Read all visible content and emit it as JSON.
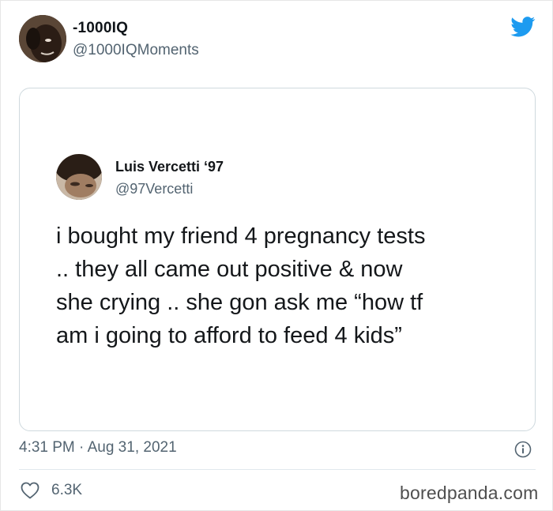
{
  "tweet": {
    "author": {
      "display_name": "-1000IQ",
      "handle": "@1000IQMoments"
    },
    "timestamp": "4:31 PM · Aug 31, 2021",
    "likes": "6.3K"
  },
  "quoted_tweet": {
    "author": {
      "display_name": "Luis Vercetti ‘97",
      "handle": "@97Vercetti"
    },
    "text": "i bought my friend 4 pregnancy tests\n.. they all came out positive & now\nshe crying .. she gon ask me “how tf\nam i going to afford to feed 4 kids”"
  },
  "watermark": "boredpanda.com",
  "icons": {
    "brand": "twitter-bird-icon",
    "info": "info-icon",
    "like": "heart-icon"
  },
  "colors": {
    "twitter_blue": "#1d9bf0",
    "secondary_text": "#536471",
    "border": "#cfd9de"
  }
}
